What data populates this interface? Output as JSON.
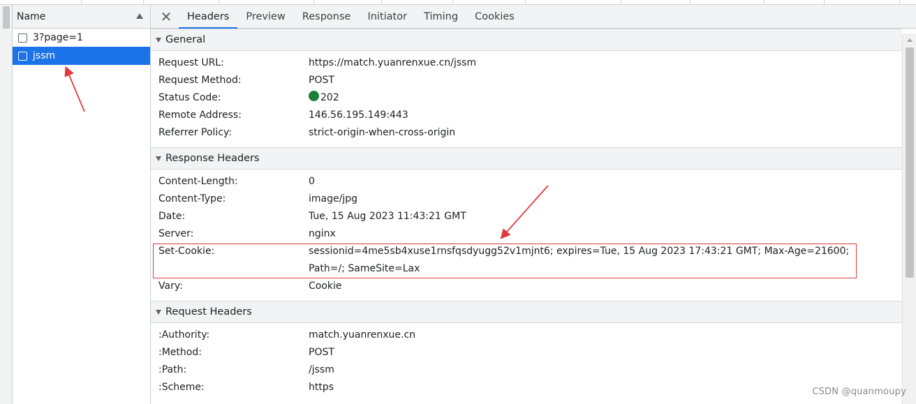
{
  "name_column": {
    "header": "Name",
    "requests": [
      {
        "name": "3?page=1",
        "selected": false
      },
      {
        "name": "jssm",
        "selected": true
      }
    ]
  },
  "tabs": [
    {
      "label": "Headers",
      "active": true
    },
    {
      "label": "Preview",
      "active": false
    },
    {
      "label": "Response",
      "active": false
    },
    {
      "label": "Initiator",
      "active": false
    },
    {
      "label": "Timing",
      "active": false
    },
    {
      "label": "Cookies",
      "active": false
    }
  ],
  "general": {
    "title": "General",
    "rows": [
      {
        "key": "Request URL:",
        "value": "https://match.yuanrenxue.cn/jssm"
      },
      {
        "key": "Request Method:",
        "value": "POST"
      },
      {
        "key": "Status Code:",
        "value": "202"
      },
      {
        "key": "Remote Address:",
        "value": "146.56.195.149:443"
      },
      {
        "key": "Referrer Policy:",
        "value": "strict-origin-when-cross-origin"
      }
    ]
  },
  "response_headers": {
    "title": "Response Headers",
    "rows": [
      {
        "key": "Content-Length:",
        "value": "0"
      },
      {
        "key": "Content-Type:",
        "value": "image/jpg"
      },
      {
        "key": "Date:",
        "value": "Tue, 15 Aug 2023 11:43:21 GMT"
      },
      {
        "key": "Server:",
        "value": "nginx"
      },
      {
        "key": "Set-Cookie:",
        "value": "sessionid=4me5sb4xuse1rnsfqsdyugg52v1mjnt6; expires=Tue, 15 Aug 2023 17:43:21 GMT; Max-Age=21600; Path=/; SameSite=Lax"
      },
      {
        "key": "Vary:",
        "value": "Cookie"
      }
    ]
  },
  "request_headers": {
    "title": "Request Headers",
    "rows": [
      {
        "key": ":Authority:",
        "value": "match.yuanrenxue.cn"
      },
      {
        "key": ":Method:",
        "value": "POST"
      },
      {
        "key": ":Path:",
        "value": "/jssm"
      },
      {
        "key": ":Scheme:",
        "value": "https"
      }
    ]
  },
  "colors": {
    "selected_row": "#1a73e8",
    "status_ok": "#188038",
    "annotation": "#e0393c"
  },
  "watermark": "CSDN @quanmoupy"
}
